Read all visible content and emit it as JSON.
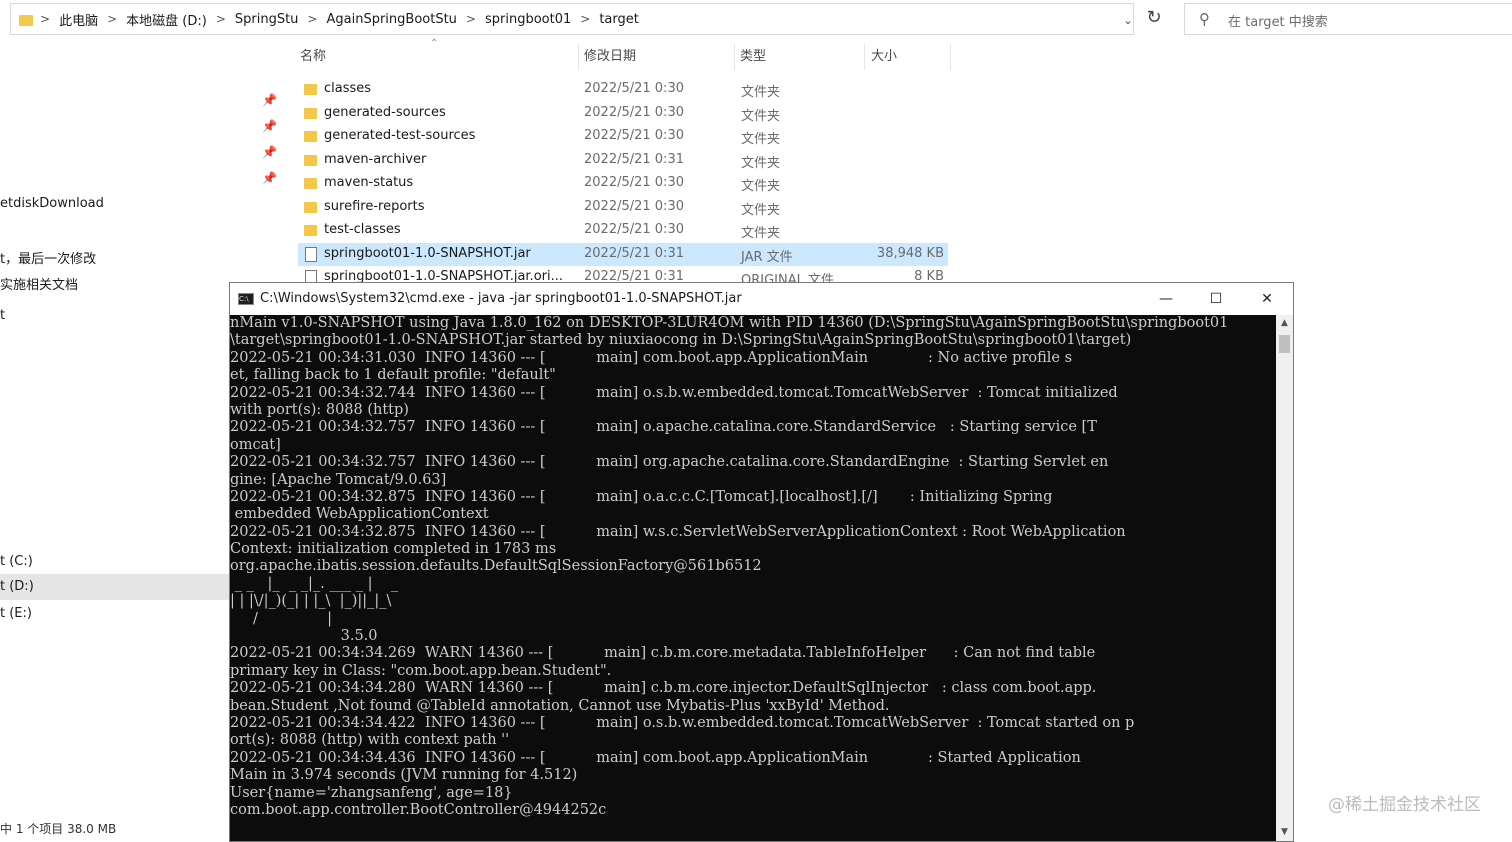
{
  "address_bar": {
    "crumbs": [
      "此电脑",
      "本地磁盘 (D:)",
      "SpringStu",
      "AgainSpringBootStu",
      "springboot01",
      "target"
    ],
    "separator": ">"
  },
  "search": {
    "placeholder": "在 target 中搜索"
  },
  "columns": {
    "name": "名称",
    "date": "修改日期",
    "type": "类型",
    "size": "大小"
  },
  "files": [
    {
      "name": "classes",
      "date": "2022/5/21 0:30",
      "type": "文件夹",
      "size": ""
    },
    {
      "name": "generated-sources",
      "date": "2022/5/21 0:30",
      "type": "文件夹",
      "size": ""
    },
    {
      "name": "generated-test-sources",
      "date": "2022/5/21 0:30",
      "type": "文件夹",
      "size": ""
    },
    {
      "name": "maven-archiver",
      "date": "2022/5/21 0:31",
      "type": "文件夹",
      "size": ""
    },
    {
      "name": "maven-status",
      "date": "2022/5/21 0:30",
      "type": "文件夹",
      "size": ""
    },
    {
      "name": "surefire-reports",
      "date": "2022/5/21 0:30",
      "type": "文件夹",
      "size": ""
    },
    {
      "name": "test-classes",
      "date": "2022/5/21 0:30",
      "type": "文件夹",
      "size": ""
    },
    {
      "name": "springboot01-1.0-SNAPSHOT.jar",
      "date": "2022/5/21 0:31",
      "type": "JAR 文件",
      "size": "38,948 KB"
    },
    {
      "name": "springboot01-1.0-SNAPSHOT.jar.ori...",
      "date": "2022/5/21 0:31",
      "type": "ORIGINAL 文件",
      "size": "8 KB"
    }
  ],
  "sidebar": {
    "items": [
      "etdiskDownload",
      "t，最后一次修改",
      "实施相关文档",
      "t",
      "t (C:)",
      "t (D:)",
      "t (E:)"
    ]
  },
  "status": "中 1 个项目  38.0 MB",
  "cmd": {
    "title": "C:\\Windows\\System32\\cmd.exe - java  -jar springboot01-1.0-SNAPSHOT.jar",
    "lines": [
      "nMain v1.0-SNAPSHOT using Java 1.8.0_162 on DESKTOP-3LUR4OM with PID 14360 (D:\\SpringStu\\AgainSpringBootStu\\springboot01",
      "\\target\\springboot01-1.0-SNAPSHOT.jar started by niuxiaocong in D:\\SpringStu\\AgainSpringBootStu\\springboot01\\target)",
      "2022-05-21 00:34:31.030  INFO 14360 --- [           main] com.boot.app.ApplicationMain             : No active profile s",
      "et, falling back to 1 default profile: \"default\"",
      "2022-05-21 00:34:32.744  INFO 14360 --- [           main] o.s.b.w.embedded.tomcat.TomcatWebServer  : Tomcat initialized",
      "with port(s): 8088 (http)",
      "2022-05-21 00:34:32.757  INFO 14360 --- [           main] o.apache.catalina.core.StandardService   : Starting service [T",
      "omcat]",
      "2022-05-21 00:34:32.757  INFO 14360 --- [           main] org.apache.catalina.core.StandardEngine  : Starting Servlet en",
      "gine: [Apache Tomcat/9.0.63]",
      "2022-05-21 00:34:32.875  INFO 14360 --- [           main] o.a.c.c.C.[Tomcat].[localhost].[/]       : Initializing Spring",
      " embedded WebApplicationContext",
      "2022-05-21 00:34:32.875  INFO 14360 --- [           main] w.s.c.ServletWebServerApplicationContext : Root WebApplication",
      "Context: initialization completed in 1783 ms",
      "org.apache.ibatis.session.defaults.DefaultSqlSessionFactory@561b6512",
      " _ _   |_  _ _|_. ___ _ |    _",
      "| | |\\/|_)(_| | |_\\  |_)||_|_\\",
      "     /               |",
      "                        3.5.0",
      "2022-05-21 00:34:34.269  WARN 14360 --- [           main] c.b.m.core.metadata.TableInfoHelper      : Can not find table",
      "primary key in Class: \"com.boot.app.bean.Student\".",
      "2022-05-21 00:34:34.280  WARN 14360 --- [           main] c.b.m.core.injector.DefaultSqlInjector   : class com.boot.app.",
      "bean.Student ,Not found @TableId annotation, Cannot use Mybatis-Plus 'xxById' Method.",
      "2022-05-21 00:34:34.422  INFO 14360 --- [           main] o.s.b.w.embedded.tomcat.TomcatWebServer  : Tomcat started on p",
      "ort(s): 8088 (http) with context path ''",
      "2022-05-21 00:34:34.436  INFO 14360 --- [           main] com.boot.app.ApplicationMain             : Started Application",
      "Main in 3.974 seconds (JVM running for 4.512)",
      "User{name='zhangsanfeng', age=18}",
      "com.boot.app.controller.BootController@4944252c",
      ""
    ]
  },
  "watermark": "@稀土掘金技术社区"
}
